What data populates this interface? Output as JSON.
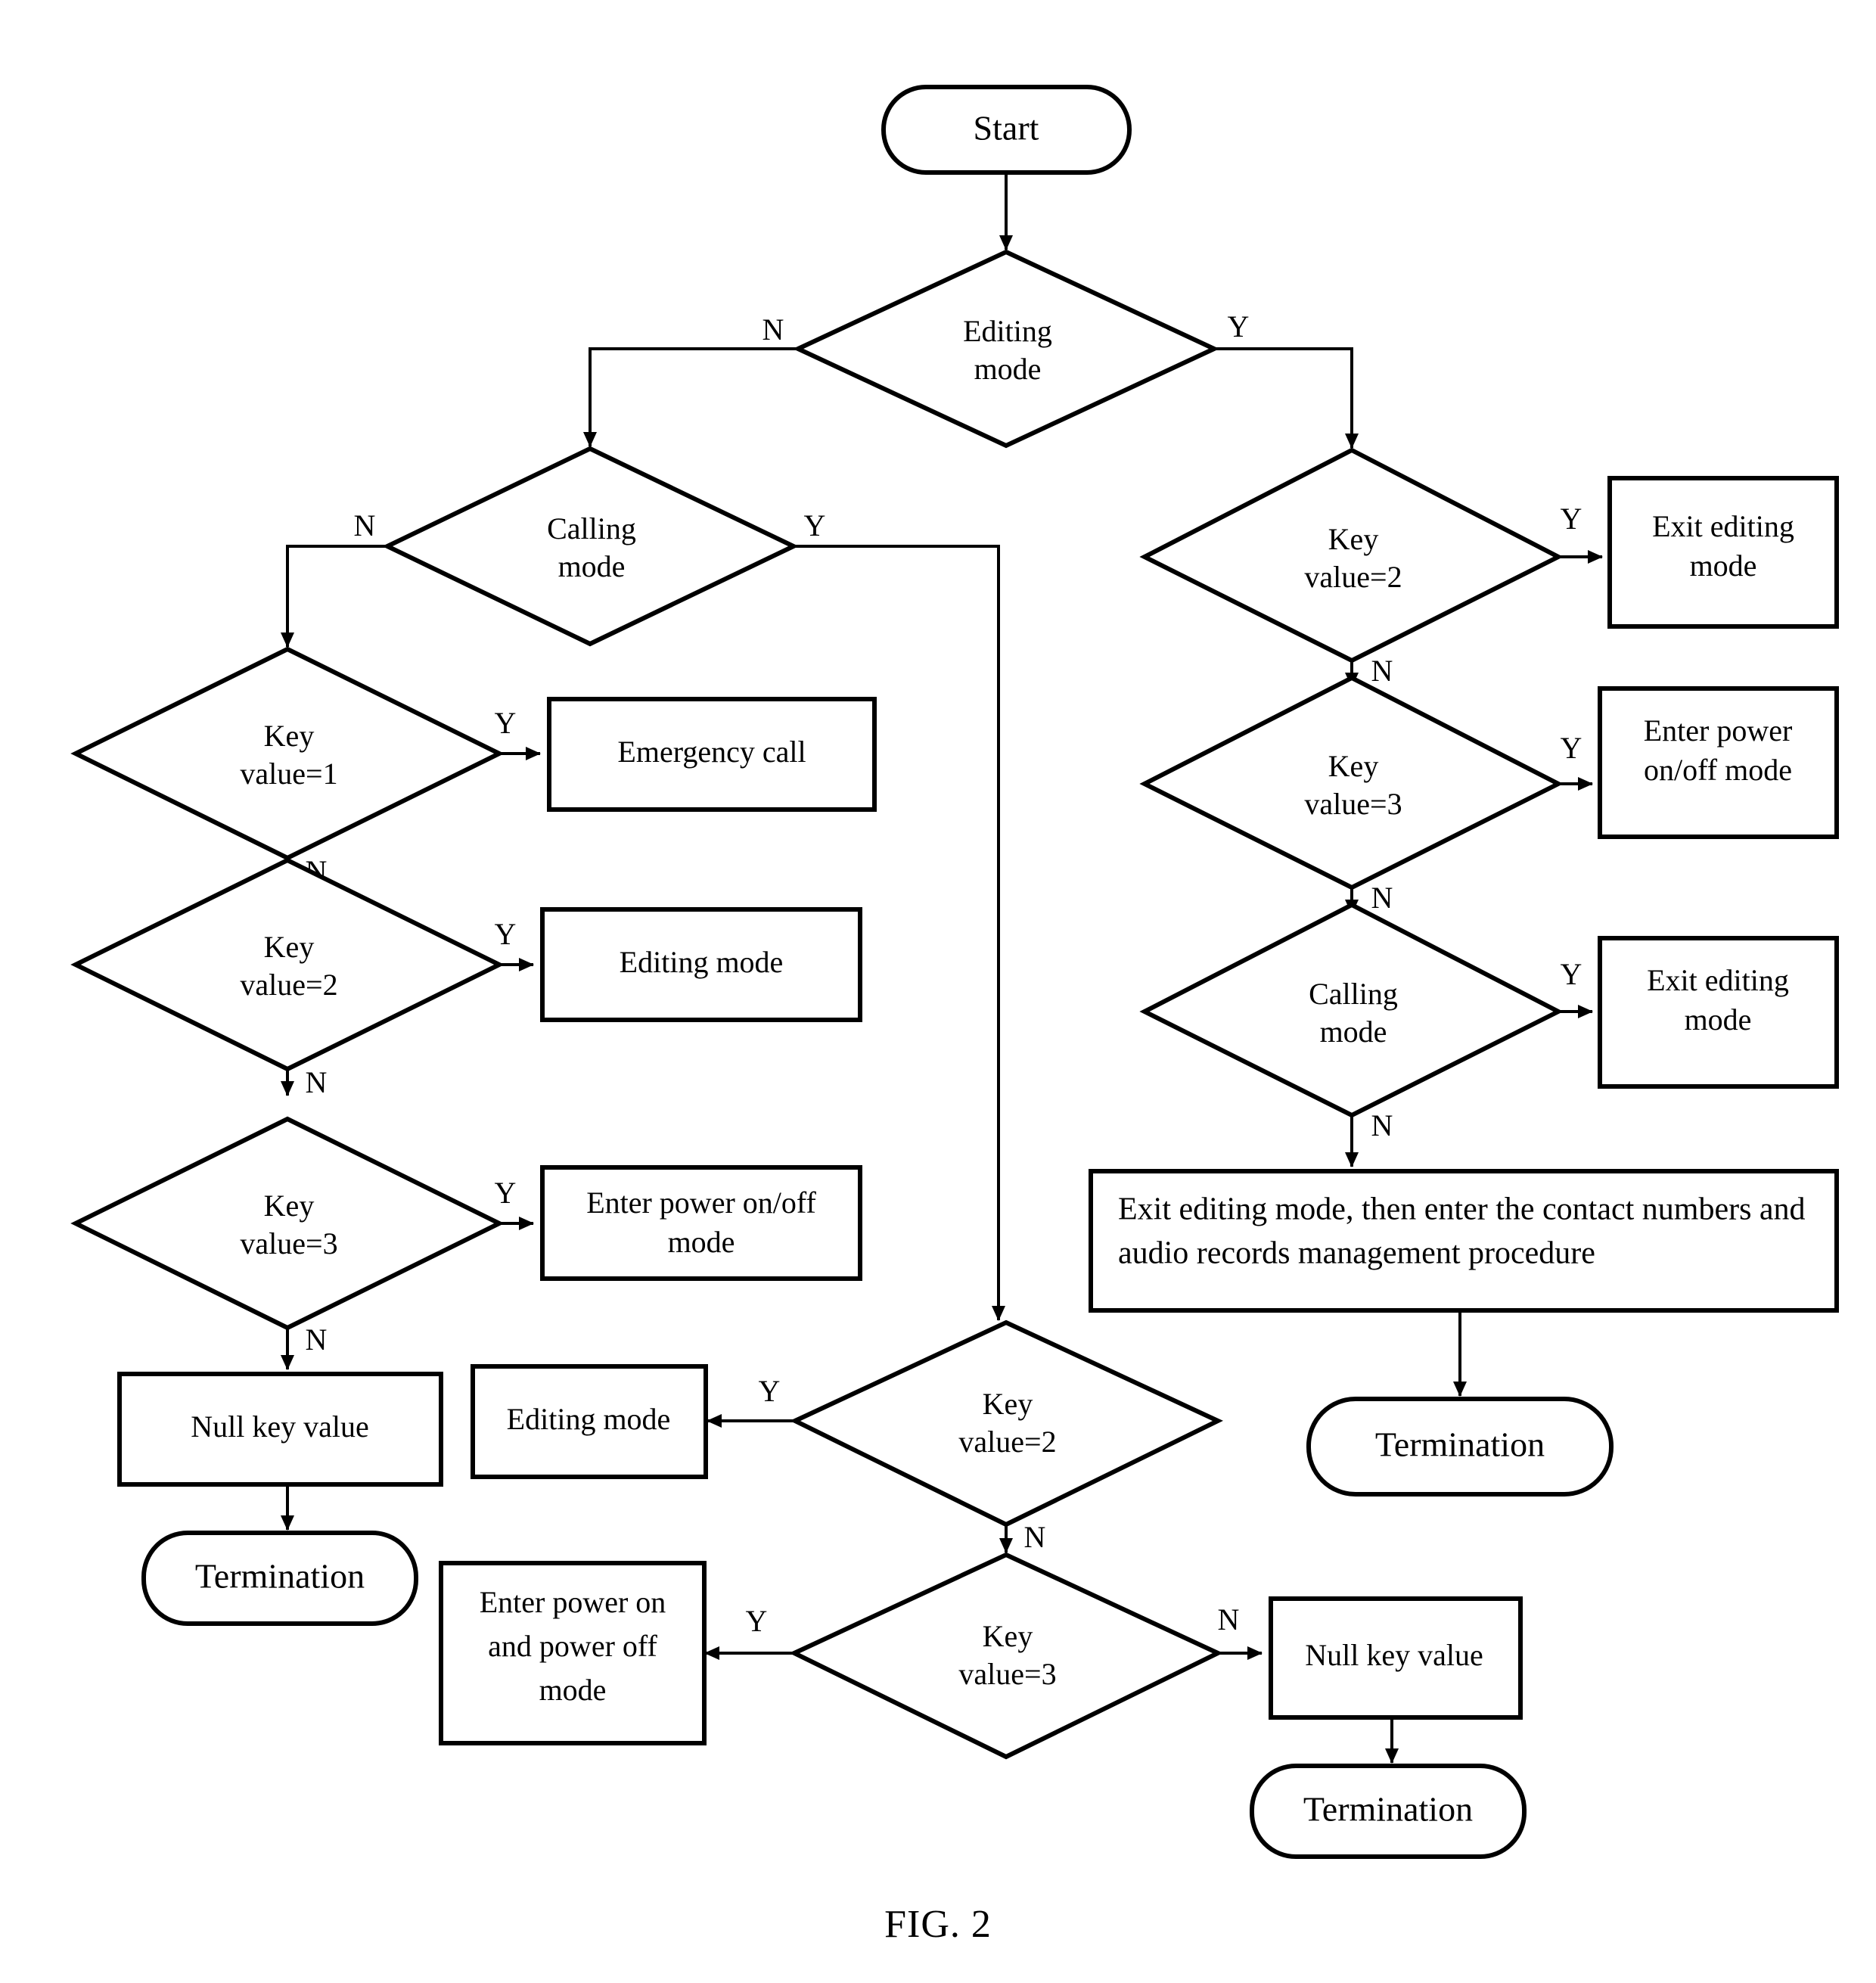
{
  "figure": {
    "caption": "FIG. 2"
  },
  "labels": {
    "yes": "Y",
    "no": "N"
  },
  "nodes": {
    "start": {
      "text": "Start",
      "shape": "terminator"
    },
    "editing_mode_decision": {
      "line1": "Editing",
      "line2": "mode",
      "shape": "decision"
    },
    "calling_mode_decision": {
      "line1": "Calling",
      "line2": "mode",
      "shape": "decision"
    },
    "left_key1": {
      "line1": "Key",
      "line2": "value=1",
      "shape": "decision"
    },
    "left_emergency_call": {
      "text": "Emergency call",
      "shape": "process"
    },
    "left_key2": {
      "line1": "Key",
      "line2": "value=2",
      "shape": "decision"
    },
    "left_editing_mode": {
      "text": "Editing mode",
      "shape": "process"
    },
    "left_key3": {
      "line1": "Key",
      "line2": "value=3",
      "shape": "decision"
    },
    "left_enter_power": {
      "line1": "Enter power on/off",
      "line2": "mode",
      "shape": "process"
    },
    "left_null_key_value": {
      "text": "Null key value",
      "shape": "process"
    },
    "left_termination": {
      "text": "Termination",
      "shape": "terminator"
    },
    "center_key2": {
      "line1": "Key",
      "line2": "value=2",
      "shape": "decision"
    },
    "center_editing_mode": {
      "text": "Editing mode",
      "shape": "process"
    },
    "center_key3": {
      "line1": "Key",
      "line2": "value=3",
      "shape": "decision"
    },
    "center_enter_power": {
      "line1": "Enter power on",
      "line2": "and power off",
      "line3": "mode",
      "shape": "process"
    },
    "center_null_key_value": {
      "text": "Null key value",
      "shape": "process"
    },
    "center_termination": {
      "text": "Termination",
      "shape": "terminator"
    },
    "right_key2": {
      "line1": "Key",
      "line2": "value=2",
      "shape": "decision"
    },
    "right_exit_editing_1": {
      "line1": "Exit editing",
      "line2": "mode",
      "shape": "process"
    },
    "right_key3": {
      "line1": "Key",
      "line2": "value=3",
      "shape": "decision"
    },
    "right_enter_power": {
      "line1": "Enter power",
      "line2": "on/off mode",
      "shape": "process"
    },
    "right_calling_mode": {
      "line1": "Calling",
      "line2": "mode",
      "shape": "decision"
    },
    "right_exit_editing_2": {
      "line1": "Exit editing",
      "line2": "mode",
      "shape": "process"
    },
    "right_exit_enter_contacts": {
      "line1": "Exit editing mode, then enter the contact numbers and",
      "line2": "audio records management procedure",
      "shape": "process"
    },
    "right_termination": {
      "text": "Termination",
      "shape": "terminator"
    }
  },
  "edges": [
    {
      "from": "start",
      "to": "editing_mode_decision",
      "label": ""
    },
    {
      "from": "editing_mode_decision",
      "to": "calling_mode_decision",
      "label": "N"
    },
    {
      "from": "editing_mode_decision",
      "to": "right_key2",
      "label": "Y"
    },
    {
      "from": "calling_mode_decision",
      "to": "left_key1",
      "label": "N"
    },
    {
      "from": "calling_mode_decision",
      "to": "center_key2",
      "label": "Y"
    },
    {
      "from": "left_key1",
      "to": "left_emergency_call",
      "label": "Y"
    },
    {
      "from": "left_key1",
      "to": "left_key2",
      "label": "N"
    },
    {
      "from": "left_key2",
      "to": "left_editing_mode",
      "label": "Y"
    },
    {
      "from": "left_key2",
      "to": "left_key3",
      "label": "N"
    },
    {
      "from": "left_key3",
      "to": "left_enter_power",
      "label": "Y"
    },
    {
      "from": "left_key3",
      "to": "left_null_key_value",
      "label": "N"
    },
    {
      "from": "left_null_key_value",
      "to": "left_termination",
      "label": ""
    },
    {
      "from": "center_key2",
      "to": "center_editing_mode",
      "label": "Y"
    },
    {
      "from": "center_key2",
      "to": "center_key3",
      "label": "N"
    },
    {
      "from": "center_key3",
      "to": "center_enter_power",
      "label": "Y"
    },
    {
      "from": "center_key3",
      "to": "center_null_key_value",
      "label": "N"
    },
    {
      "from": "center_null_key_value",
      "to": "center_termination",
      "label": ""
    },
    {
      "from": "right_key2",
      "to": "right_exit_editing_1",
      "label": "Y"
    },
    {
      "from": "right_key2",
      "to": "right_key3",
      "label": "N"
    },
    {
      "from": "right_key3",
      "to": "right_enter_power",
      "label": "Y"
    },
    {
      "from": "right_key3",
      "to": "right_calling_mode",
      "label": "N"
    },
    {
      "from": "right_calling_mode",
      "to": "right_exit_editing_2",
      "label": "Y"
    },
    {
      "from": "right_calling_mode",
      "to": "right_exit_enter_contacts",
      "label": "N"
    },
    {
      "from": "right_exit_enter_contacts",
      "to": "right_termination",
      "label": ""
    }
  ]
}
